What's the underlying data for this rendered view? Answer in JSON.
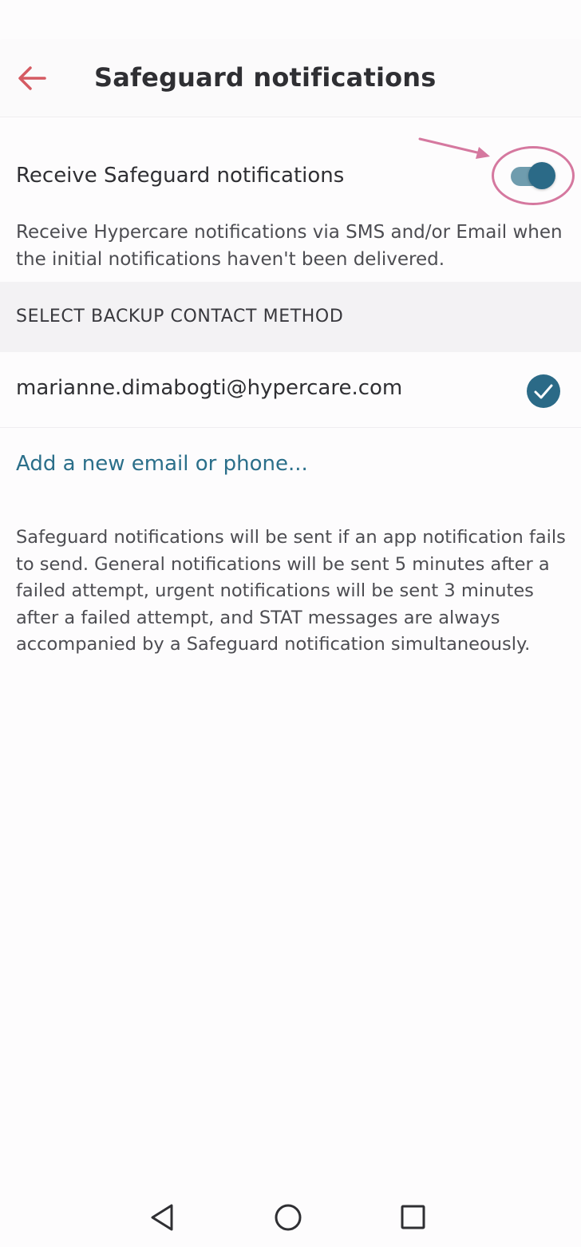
{
  "header": {
    "title": "Safeguard notifications",
    "back_icon": "back-arrow-icon",
    "back_color": "#d55a62"
  },
  "safeguard": {
    "toggle_label": "Receive Safeguard notifications",
    "toggle_on": true,
    "description": "Receive Hypercare notifications via SMS and/or Email when the initial notifications haven't been delivered."
  },
  "backup": {
    "section_title": "SELECT BACKUP CONTACT METHOD",
    "contacts": [
      {
        "value": "marianne.dimabogti@hypercare.com",
        "selected": true
      }
    ],
    "add_link": "Add a new email or phone..."
  },
  "info": {
    "text": "Safeguard notifications will be sent if an app notification fails to send. General notifications will be sent 5 minutes after a failed attempt, urgent notifications will be sent 3 minutes after a failed attempt, and STAT messages are always accompanied by a Safeguard notification simultaneously."
  },
  "nav": {
    "back_icon": "triangle-back-icon",
    "home_icon": "circle-home-icon",
    "recents_icon": "square-recents-icon"
  },
  "colors": {
    "accent": "#2b6a87",
    "link": "#2b6f8a",
    "annotation": "#d5789f"
  }
}
